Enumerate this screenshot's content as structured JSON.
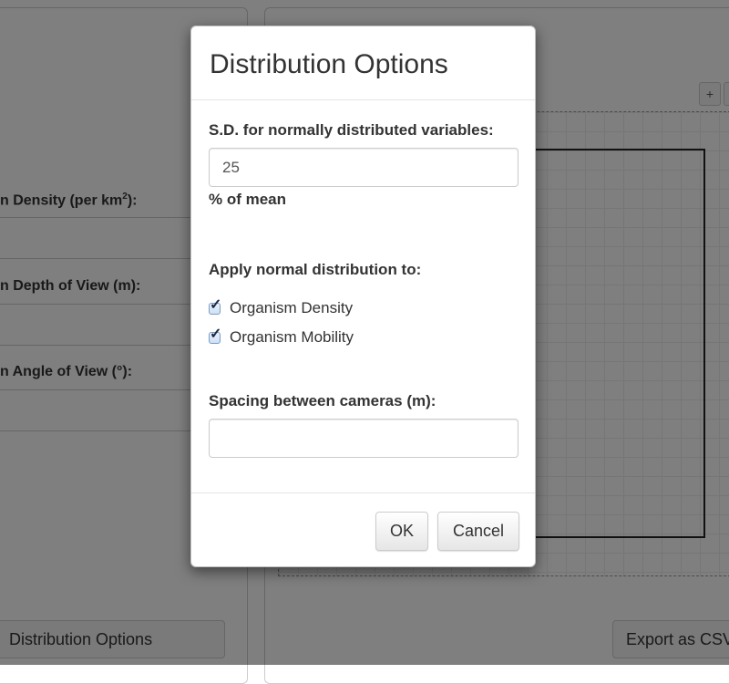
{
  "background": {
    "fields": [
      {
        "label": "n Density (per km",
        "sup": "2",
        "suffix": "):"
      },
      {
        "label": "n Depth of View (m):"
      },
      {
        "label": "n Angle of View (°):"
      }
    ],
    "distribution_button": "Distribution Options",
    "export_button": "Export as CSV",
    "zoom_in": "+"
  },
  "modal": {
    "title": "Distribution Options",
    "sd_label": "S.D. for normally distributed variables:",
    "sd_value": "25",
    "sd_unit": "% of mean",
    "apply_label": "Apply normal distribution to:",
    "checkboxes": [
      {
        "label": "Organism Density",
        "checked": true
      },
      {
        "label": "Organism Mobility",
        "checked": true
      }
    ],
    "spacing_label": "Spacing between cameras (m):",
    "spacing_value": "",
    "ok_label": "OK",
    "cancel_label": "Cancel"
  }
}
